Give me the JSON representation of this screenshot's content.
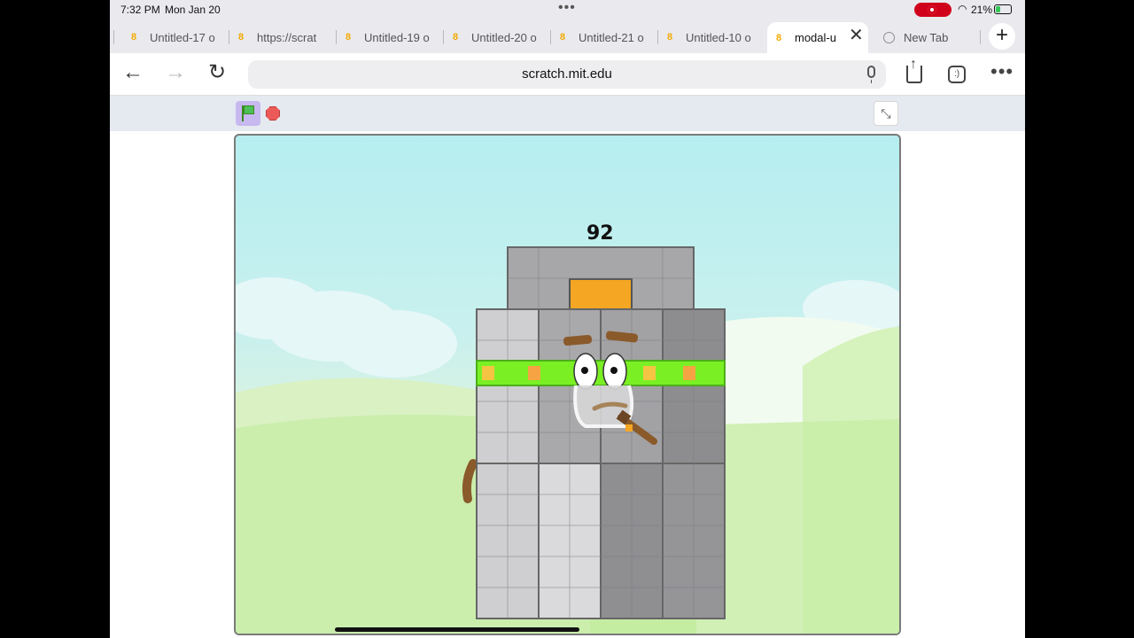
{
  "status": {
    "time": "7:32 PM",
    "date": "Mon Jan 20",
    "battery": "21%"
  },
  "tabs": [
    {
      "label": "Untitled-17 o"
    },
    {
      "label": "https://scrat"
    },
    {
      "label": "Untitled-19 o"
    },
    {
      "label": "Untitled-20 o"
    },
    {
      "label": "Untitled-21 o"
    },
    {
      "label": "Untitled-10 o"
    },
    {
      "label": "modal-u"
    },
    {
      "label": "New Tab"
    }
  ],
  "url": "scratch.mit.edu",
  "stage": {
    "number_label": "92"
  }
}
